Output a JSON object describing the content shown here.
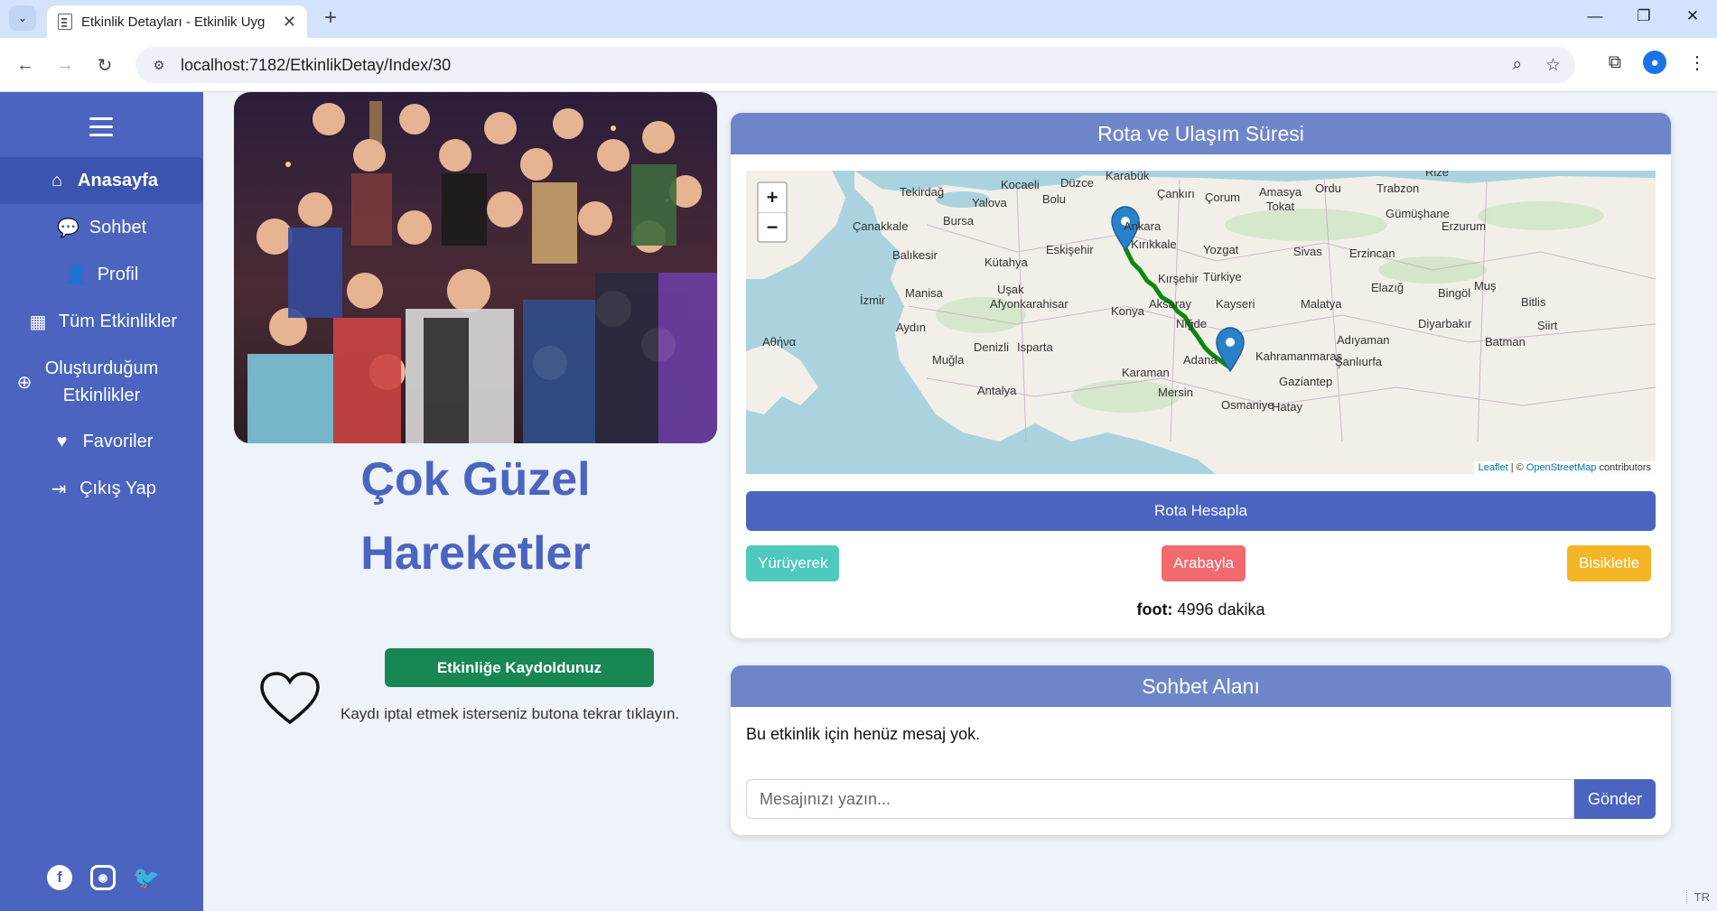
{
  "browser": {
    "tab_title": "Etkinlik Detayları - Etkinlik Uyg",
    "url": "localhost:7182/EtkinlikDetay/Index/30",
    "new_tab": "+",
    "tab_close": "✕",
    "min": "—",
    "max": "❐",
    "close": "✕"
  },
  "sidebar": {
    "items": [
      {
        "label": "Anasayfa",
        "icon": "home-icon",
        "active": true
      },
      {
        "label": "Sohbet",
        "icon": "chat-icon"
      },
      {
        "label": "Profil",
        "icon": "user-icon"
      },
      {
        "label": "Tüm Etkinlikler",
        "icon": "calendar-icon"
      },
      {
        "label": "Oluşturduğum Etkinlikler",
        "line1": "Oluşturduğum",
        "line2": "Etkinlikler",
        "icon": "plus-circle-icon"
      },
      {
        "label": "Favoriler",
        "icon": "heart-icon"
      },
      {
        "label": "Çıkış Yap",
        "icon": "sign-out-icon"
      }
    ],
    "social": [
      "facebook-icon",
      "instagram-icon",
      "twitter-icon"
    ]
  },
  "event": {
    "title_line1": "Çok Güzel",
    "title_line2": "Hareketler",
    "register_label": "Etkinliğe Kaydoldunuz",
    "cancel_note": "Kaydı iptal etmek isterseniz butona tekrar tıklayın."
  },
  "route": {
    "header": "Rota ve Ulaşım Süresi",
    "zoom_in": "+",
    "zoom_out": "−",
    "attribution_leaflet": "Leaflet",
    "attribution_sep": " | © ",
    "attribution_osm": "OpenStreetMap",
    "attribution_tail": " contributors",
    "map_labels": [
      "Kocaeli",
      "Düzce",
      "Karabük",
      "Çankırı",
      "Çorum",
      "Amasya",
      "Ordu",
      "Trabzon",
      "Rize",
      "Tekirdağ",
      "Yalova",
      "Bolu",
      "Tokat",
      "Gümüşhane",
      "Çanakkale",
      "Bursa",
      "Ankara",
      "Kırıkkale",
      "Yozgat",
      "Sivas",
      "Erzincan",
      "Erzurum",
      "Balıkesir",
      "Eskişehir",
      "Kütahya",
      "Kırşehir",
      "Türkiye",
      "Manisa",
      "Uşak",
      "İzmir",
      "Afyonkarahisar",
      "Aksaray",
      "Kayseri",
      "Malatya",
      "Elazığ",
      "Bingöl",
      "Muş",
      "Bitlis",
      "Siirt",
      "Aydın",
      "Niğde",
      "Diyarbakır",
      "Αθήνα",
      "Denizli",
      "Isparta",
      "Kahramanmaraş",
      "Adıyaman",
      "Batman",
      "Muğla",
      "Karaman",
      "Adana",
      "Şanlıurfa",
      "Antalya",
      "Mersin",
      "Gaziantep",
      "Hatay",
      "Osmaniye",
      "Konya"
    ],
    "calc_label": "Rota Hesapla",
    "walk_label": "Yürüyerek",
    "car_label": "Arabayla",
    "bike_label": "Bisikletle",
    "duration_mode": "foot:",
    "duration_value": "4996 dakika"
  },
  "chat": {
    "header": "Sohbet Alanı",
    "empty_text": "Bu etkinlik için henüz mesaj yok.",
    "placeholder": "Mesajınızı yazın...",
    "send_label": "Gönder"
  },
  "lang": "TR",
  "colors": {
    "sidebar": "#4a64c0",
    "primary": "#4a64c0",
    "card_header": "#6e86c9",
    "success": "#198754",
    "walk": "#4ec9bd",
    "car": "#f06a6e",
    "bike": "#f4b526",
    "route_line": "#0a8a0a"
  }
}
